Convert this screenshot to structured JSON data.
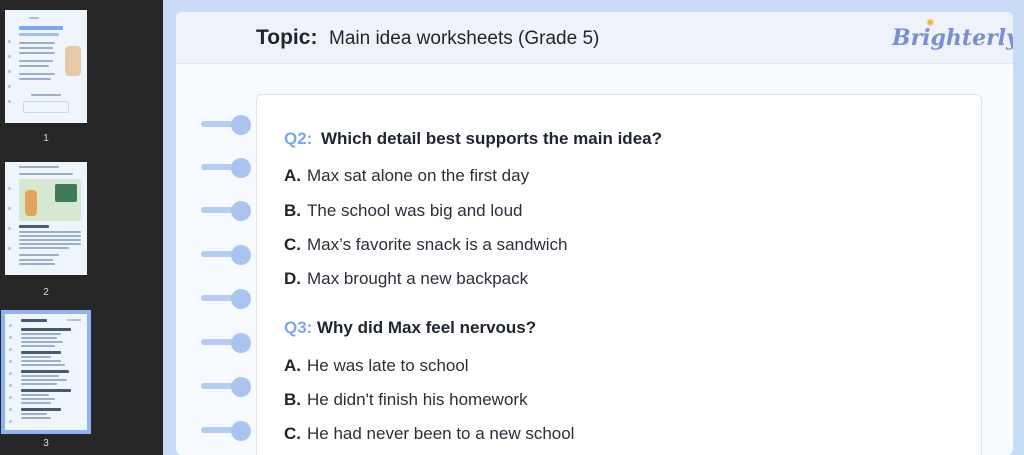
{
  "thumbnails": [
    {
      "page_number": "1",
      "selected": false
    },
    {
      "page_number": "2",
      "selected": false
    },
    {
      "page_number": "3",
      "selected": true
    }
  ],
  "header": {
    "topic_label": "Topic:",
    "topic_text": "Main idea worksheets (Grade 5)",
    "brand": "Brighterly"
  },
  "questions": [
    {
      "number": "Q2:",
      "text": "Which detail best supports the main idea?",
      "options": [
        {
          "letter": "A.",
          "text": "Max sat alone on the first day"
        },
        {
          "letter": "B.",
          "text": "The school was big and loud"
        },
        {
          "letter": "C.",
          "text": "Max’s favorite snack is a sandwich"
        },
        {
          "letter": "D.",
          "text": "Max brought a new backpack"
        }
      ]
    },
    {
      "number": "Q3:",
      "text": "Why did Max feel nervous?",
      "options": [
        {
          "letter": "A.",
          "text": "He was late to school"
        },
        {
          "letter": "B.",
          "text": "He didn't finish his homework"
        },
        {
          "letter": "C.",
          "text": "He had never been to a new school"
        }
      ]
    }
  ],
  "colors": {
    "accent": "#7fa6e8",
    "brand": "#7a8fd1",
    "page_bg": "#c9dcf5",
    "sidebar_bg": "#262626"
  }
}
